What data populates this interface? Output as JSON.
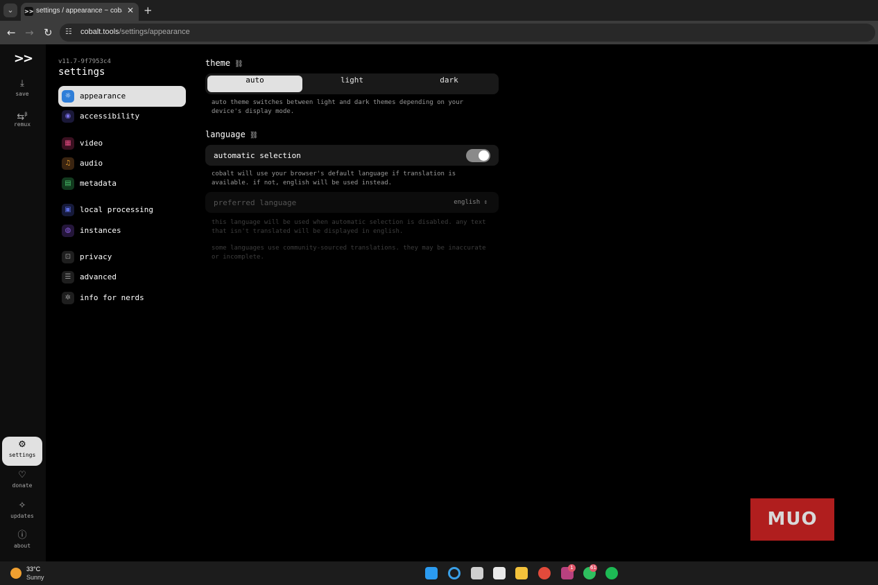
{
  "browser": {
    "tab_title": "settings / appearance ~ cobalt",
    "tab_icon_text": ">>",
    "tab_close": "✕",
    "new_tab": "+",
    "url_host": "cobalt.tools",
    "url_path": "/settings/appearance"
  },
  "rail": {
    "logo": ">>",
    "items": [
      {
        "label": "save",
        "icon": "download-icon",
        "glyph": "⤓"
      },
      {
        "label": "remux",
        "icon": "remux-icon",
        "glyph": "⇆",
        "beta": "β"
      },
      {
        "label": "settings",
        "icon": "gear-icon",
        "glyph": "⚙"
      },
      {
        "label": "donate",
        "icon": "heart-icon",
        "glyph": "♡"
      },
      {
        "label": "updates",
        "icon": "sparkle-icon",
        "glyph": "✧"
      },
      {
        "label": "about",
        "icon": "info-icon",
        "glyph": "ⓘ"
      }
    ]
  },
  "settings_nav": {
    "version": "v11.7-9f7953c4",
    "title": "settings",
    "items": [
      {
        "label": "appearance",
        "icon": "sun-icon",
        "glyph": "☼",
        "color": "#2f7ed8"
      },
      {
        "label": "accessibility",
        "icon": "accessibility-icon",
        "glyph": "◉",
        "color": "#5a4fcf"
      },
      {
        "label": "video",
        "icon": "film-icon",
        "glyph": "▦",
        "color": "#d9346f"
      },
      {
        "label": "audio",
        "icon": "music-icon",
        "glyph": "♫",
        "color": "#d98a2b"
      },
      {
        "label": "metadata",
        "icon": "file-icon",
        "glyph": "▤",
        "color": "#3aaa5c"
      },
      {
        "label": "local processing",
        "icon": "chip-icon",
        "glyph": "▣",
        "color": "#4a5bd4"
      },
      {
        "label": "instances",
        "icon": "globe-icon",
        "glyph": "◍",
        "color": "#7a4fd4"
      },
      {
        "label": "privacy",
        "icon": "lock-icon",
        "glyph": "⊡",
        "color": "#8a8a8a"
      },
      {
        "label": "advanced",
        "icon": "sliders-icon",
        "glyph": "☰",
        "color": "#8a8a8a"
      },
      {
        "label": "info for nerds",
        "icon": "bug-icon",
        "glyph": "✲",
        "color": "#8a8a8a"
      }
    ]
  },
  "content": {
    "theme": {
      "title": "theme",
      "link_glyph": "⛓",
      "options": [
        "auto",
        "light",
        "dark"
      ],
      "selected": "auto",
      "description": "auto theme switches between light and dark themes depending on your device's display mode."
    },
    "language": {
      "title": "language",
      "link_glyph": "⛓",
      "toggle_label": "automatic selection",
      "toggle_on": true,
      "toggle_description": "cobalt will use your browser's default language if translation is available. if not, english will be used instead.",
      "preferred_label": "preferred language",
      "preferred_value": "english",
      "preferred_description": "this language will be used when automatic selection is disabled. any text that isn't translated will be displayed in english.",
      "community_note": "some languages use community-sourced translations. they may be inaccurate or incomplete."
    }
  },
  "watermark": "MUO",
  "taskbar": {
    "temp": "33°C",
    "condition": "Sunny",
    "apps": [
      {
        "icon": "windows-start-icon",
        "color": "#2b9bf0"
      },
      {
        "icon": "search-icon",
        "color": "#3aa0e8"
      },
      {
        "icon": "task-view-icon",
        "color": "#cfcfcf"
      },
      {
        "icon": "store-icon",
        "color": "#e8e8e8"
      },
      {
        "icon": "file-explorer-icon",
        "color": "#f3c23b"
      },
      {
        "icon": "chrome-icon",
        "color": "#e24a3b"
      },
      {
        "icon": "slack-icon",
        "color": "#b8417f",
        "badge": "1"
      },
      {
        "icon": "whatsapp-icon",
        "color": "#2fbf5f",
        "badge": "61"
      },
      {
        "icon": "spotify-icon",
        "color": "#1db954"
      }
    ]
  }
}
